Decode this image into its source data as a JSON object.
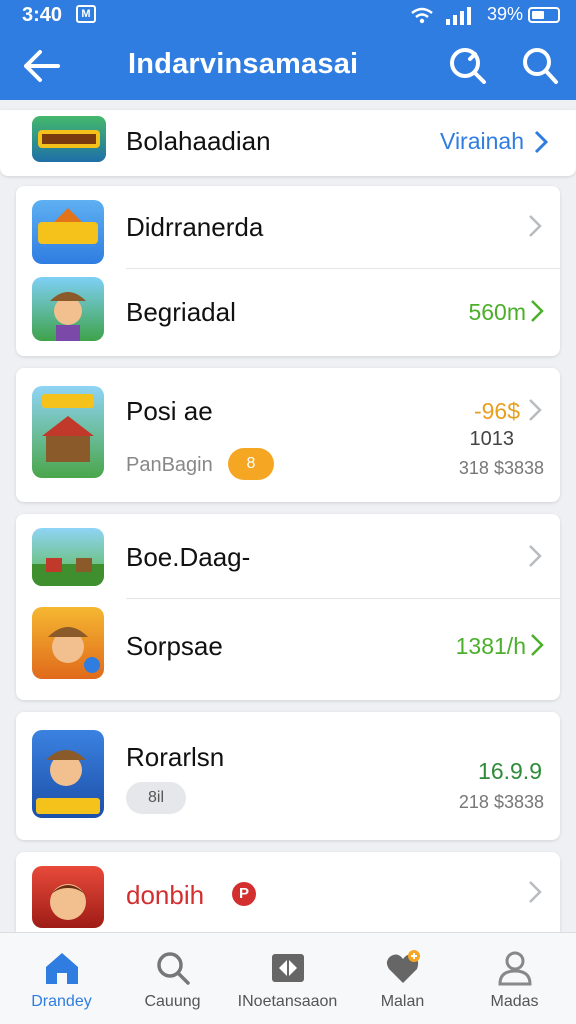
{
  "status_bar": {
    "time": "3:40",
    "notification_badge": "M",
    "battery_percent": "39%"
  },
  "header": {
    "title": "Indarvinsamasai",
    "back_icon": "arrow-left-icon",
    "search_alt_icon": "search-icon",
    "search_icon": "search-icon",
    "color": "#2f7de1"
  },
  "summary": {
    "name": "Bolahaadian",
    "link": "Virainah"
  },
  "groups": [
    {
      "rows": [
        {
          "name": "Didrranerda"
        },
        {
          "name": "Begriadal",
          "value": "560m",
          "value_color": "#4caf2a"
        }
      ]
    },
    {
      "rows": [
        {
          "name": "Posi ae",
          "label": "PanBagin",
          "pill": "8",
          "price": "-96$",
          "count": "1013",
          "sub": "318 $3838"
        }
      ]
    },
    {
      "rows": [
        {
          "name": "Boe.Daag-"
        },
        {
          "name": "Sorpsae",
          "value": "1381/h",
          "value_color": "#4caf2a"
        }
      ]
    },
    {
      "rows": [
        {
          "name": "Rorarlsn",
          "pill": "8il",
          "value": "16.9.9",
          "value_color": "#2e8b3a",
          "sub": "218 $3838"
        }
      ]
    },
    {
      "rows": [
        {
          "name": "donbih",
          "name_badge": "P",
          "name_color": "#d32f2f"
        }
      ]
    }
  ],
  "bottom_nav": [
    {
      "label": "Drandey",
      "icon": "home-icon",
      "active": true
    },
    {
      "label": "Cauung",
      "icon": "search-icon",
      "active": false
    },
    {
      "label": "INoetansaaon",
      "icon": "box-icon",
      "active": false
    },
    {
      "label": "Malan",
      "icon": "heart-icon",
      "active": false
    },
    {
      "label": "Madas",
      "icon": "profile-icon",
      "active": false
    }
  ]
}
